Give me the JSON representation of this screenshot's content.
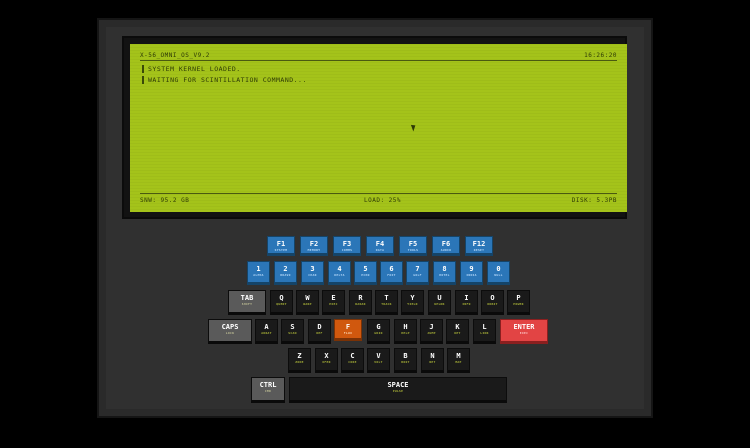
{
  "screen": {
    "title": "X-56_OMNI_OS_V9.2",
    "clock": "16:26:20",
    "lines": [
      "SYSTEM KERNEL LOADED.",
      "WAITING FOR SCINTILLATION COMMAND..."
    ],
    "footer": {
      "mem": "SNW: 95.2 GB",
      "load": "LOAD: 25%",
      "disk": "DISK: 5.3PB"
    }
  },
  "keys": {
    "f1": {
      "main": "F1",
      "sub": "SYSTEM"
    },
    "f2": {
      "main": "F2",
      "sub": "MEMORY"
    },
    "f3": {
      "main": "F3",
      "sub": "COMMS"
    },
    "f4": {
      "main": "F4",
      "sub": "DATA"
    },
    "f5": {
      "main": "F5",
      "sub": "TOOLS"
    },
    "f6": {
      "main": "F6",
      "sub": "AUDIO"
    },
    "f12": {
      "main": "F12",
      "sub": "RESET"
    },
    "n1": {
      "main": "1",
      "sub": "ALPHA"
    },
    "n2": {
      "main": "2",
      "sub": "BRAVO"
    },
    "n3": {
      "main": "3",
      "sub": "CHAR"
    },
    "n4": {
      "main": "4",
      "sub": "DELTA"
    },
    "n5": {
      "main": "5",
      "sub": "ECHO"
    },
    "n6": {
      "main": "6",
      "sub": "FOXT"
    },
    "n7": {
      "main": "7",
      "sub": "GOLF"
    },
    "n8": {
      "main": "8",
      "sub": "HOTEL"
    },
    "n9": {
      "main": "9",
      "sub": "INDIA"
    },
    "n0": {
      "main": "0",
      "sub": "NULL"
    },
    "tab": {
      "main": "TAB",
      "sub": "SHIFT"
    },
    "q": {
      "main": "Q",
      "sub": "QUERY"
    },
    "w": {
      "main": "W",
      "sub": "WARP"
    },
    "e": {
      "main": "E",
      "sub": "EXEC"
    },
    "r": {
      "main": "R",
      "sub": "RADAR"
    },
    "t": {
      "main": "T",
      "sub": "TRACK"
    },
    "y": {
      "main": "Y",
      "sub": "YIELD"
    },
    "u": {
      "main": "U",
      "sub": "UPLNK"
    },
    "i": {
      "main": "I",
      "sub": "INFO"
    },
    "o": {
      "main": "O",
      "sub": "ORBIT"
    },
    "p": {
      "main": "P",
      "sub": "POWER"
    },
    "caps": {
      "main": "CAPS",
      "sub": "LOCK"
    },
    "a": {
      "main": "A",
      "sub": "ARRAY"
    },
    "s": {
      "main": "S",
      "sub": "SCAN"
    },
    "d": {
      "main": "D",
      "sub": "DEF"
    },
    "f": {
      "main": "F",
      "sub": "FLUX"
    },
    "g": {
      "main": "G",
      "sub": "GRID"
    },
    "h": {
      "main": "H",
      "sub": "HELP"
    },
    "j": {
      "main": "J",
      "sub": "JUMP"
    },
    "k": {
      "main": "K",
      "sub": "KEY"
    },
    "l": {
      "main": "L",
      "sub": "LINK"
    },
    "enter": {
      "main": "ENTER",
      "sub": "EXEC"
    },
    "z": {
      "main": "Z",
      "sub": "ZONE"
    },
    "x": {
      "main": "X",
      "sub": "XFER"
    },
    "c": {
      "main": "C",
      "sub": "CORE"
    },
    "v": {
      "main": "V",
      "sub": "VOLT"
    },
    "b": {
      "main": "B",
      "sub": "BOOT"
    },
    "n": {
      "main": "N",
      "sub": "NET"
    },
    "m": {
      "main": "M",
      "sub": "MAP"
    },
    "ctrl": {
      "main": "CTRL",
      "sub": "CMD"
    },
    "space": {
      "main": "SPACE",
      "sub": "PULSE"
    }
  },
  "colors": {
    "screen": "#a4c31a",
    "key_blue": "#2b76b8",
    "key_red": "#e24444",
    "key_orange": "#d0580e"
  }
}
